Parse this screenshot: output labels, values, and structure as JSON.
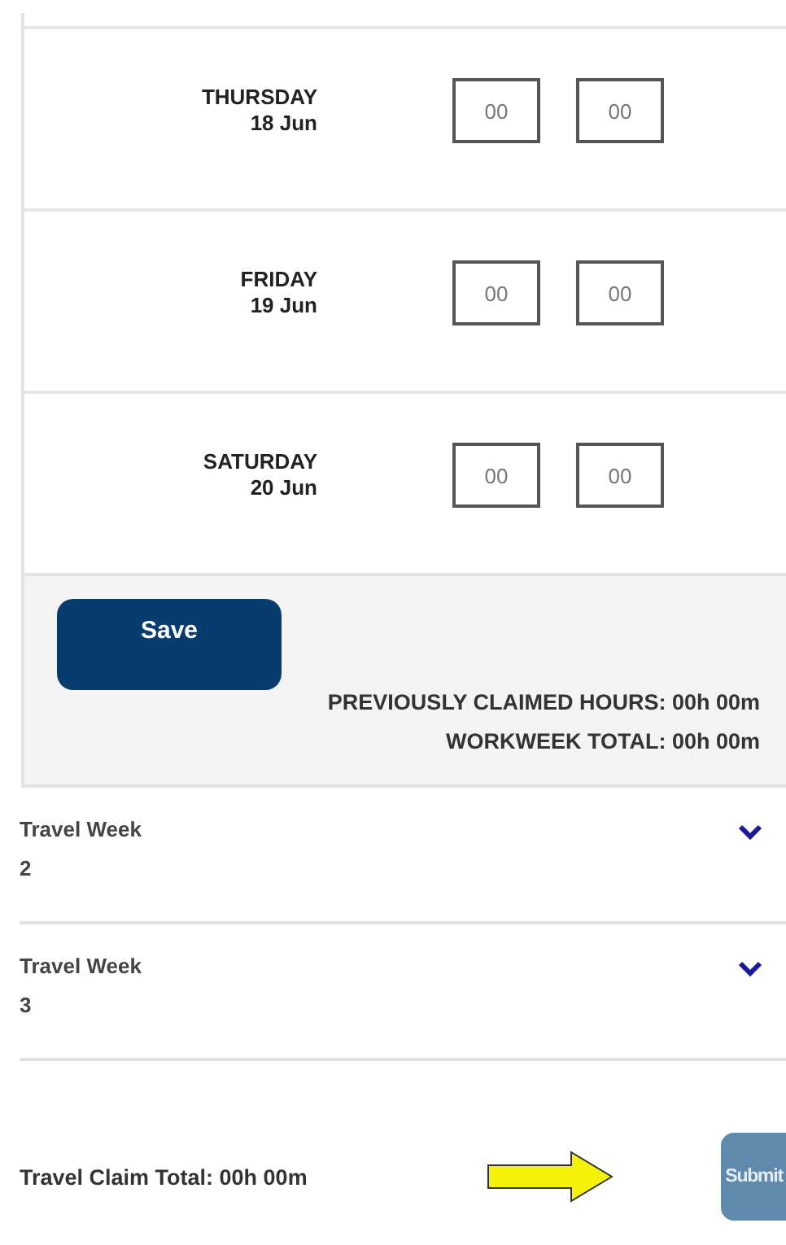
{
  "days": [
    {
      "day": "THURSDAY",
      "date": "18 Jun",
      "hours": "00",
      "minutes": "00"
    },
    {
      "day": "FRIDAY",
      "date": "19 Jun",
      "hours": "00",
      "minutes": "00"
    },
    {
      "day": "SATURDAY",
      "date": "20 Jun",
      "hours": "00",
      "minutes": "00"
    }
  ],
  "save_button": "Save",
  "previously_claimed": "PREVIOUSLY CLAIMED HOURS: 00h 00m",
  "workweek_total": "WORKWEEK TOTAL: 00h 00m",
  "travel_weeks": [
    {
      "label": "Travel Week",
      "number": "2",
      "expanded": false
    },
    {
      "label": "Travel Week",
      "number": "3",
      "expanded": false
    }
  ],
  "claim_total": "Travel Claim Total: 00h 00m",
  "submit_button": {
    "label": "Submit",
    "disabled": true
  }
}
